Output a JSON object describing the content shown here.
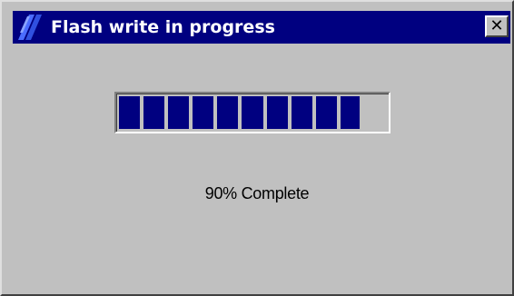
{
  "window": {
    "title": "Flash write in progress",
    "close_icon": "close-icon",
    "app_icon": "flash-app-icon"
  },
  "progress": {
    "fraction": 0.9,
    "segments_total": 11,
    "label": "90% Complete"
  },
  "colors": {
    "titlebar": "#000080",
    "face": "#c0c0c0",
    "progress_fill": "#000080"
  }
}
